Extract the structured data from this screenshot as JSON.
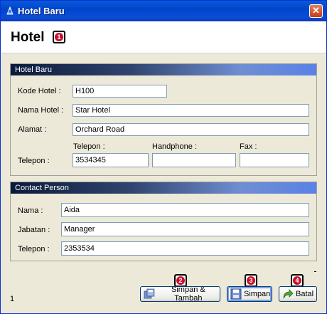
{
  "window": {
    "title": "Hotel Baru",
    "close_glyph": "✕"
  },
  "header": {
    "title": "Hotel",
    "badge": "1"
  },
  "hotel_panel": {
    "title": "Hotel Baru",
    "kode_label": "Kode Hotel :",
    "kode_value": "H100",
    "nama_label": "Nama Hotel :",
    "nama_value": "Star Hotel",
    "alamat_label": "Alamat :",
    "alamat_value": "Orchard Road",
    "telepon_row_label": "Telepon :",
    "telepon_label": "Telepon :",
    "telepon_value": "3534345",
    "handphone_label": "Handphone :",
    "handphone_value": "",
    "fax_label": "Fax :",
    "fax_value": ""
  },
  "contact_panel": {
    "title": "Contact Person",
    "nama_label": "Nama :",
    "nama_value": "Aida",
    "jabatan_label": "Jabatan :",
    "jabatan_value": "Manager",
    "telepon_label": "Telepon :",
    "telepon_value": "2353534"
  },
  "footer": {
    "status": "1",
    "badge_2": "2",
    "badge_3": "3",
    "badge_4": "4",
    "simpan_tambah_label": "Simpan & Tambah",
    "simpan_label": "Simpan",
    "batal_label": "Batal"
  },
  "colors": {
    "title_bar": "#0a4dd8",
    "panel_header_dark": "#0b1a3a",
    "panel_header_light": "#5a82e6",
    "badge_red": "#c8102e"
  },
  "icons": [
    "app-icon",
    "close-icon",
    "save-add-icon",
    "save-icon",
    "cancel-arrow-icon"
  ]
}
